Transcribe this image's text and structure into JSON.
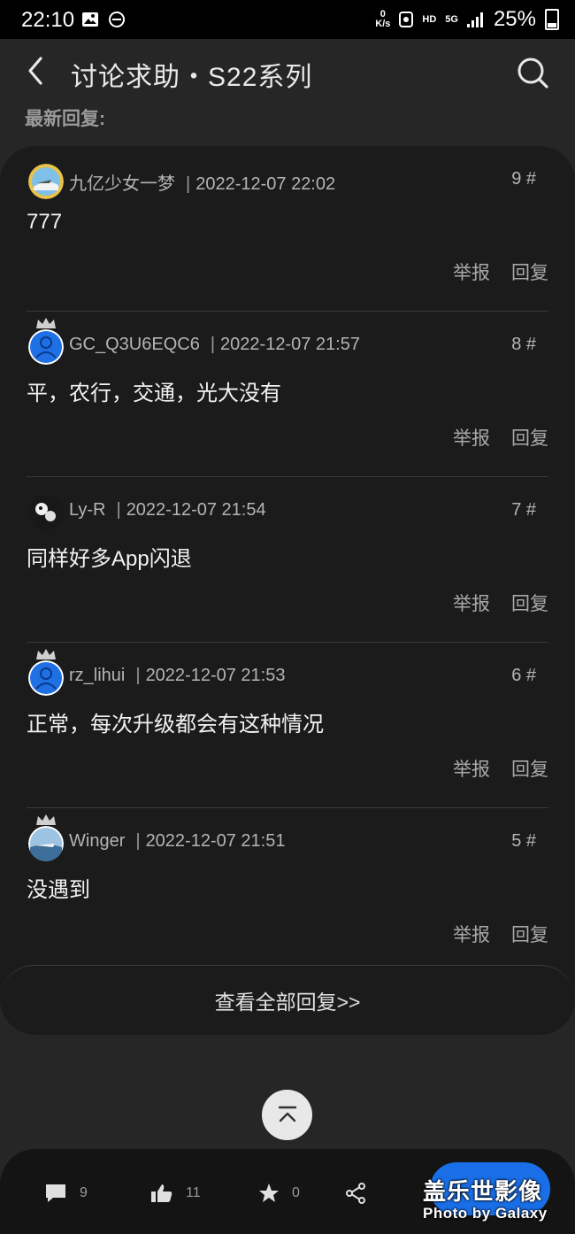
{
  "status_bar": {
    "time": "22:10",
    "net_speed_value": "0",
    "net_speed_unit": "K/s",
    "hd": "HD",
    "network": "5G",
    "battery": "25%"
  },
  "header": {
    "title": "讨论求助・S22系列",
    "back_icon": "chevron-left-icon",
    "search_icon": "search-icon"
  },
  "section_label": "最新回复:",
  "replies": [
    {
      "user": "九亿少女一梦",
      "time": "2022-12-07 22:02",
      "floor": "9 #",
      "text": "777",
      "avatar_color": "#6ab0e0",
      "crown": false
    },
    {
      "user": "GC_Q3U6EQC6",
      "time": "2022-12-07 21:57",
      "floor": "8 #",
      "text": "平，农行，交通，光大没有",
      "avatar_color": "#1f6fe5",
      "crown": true
    },
    {
      "user": "Ly-R",
      "time": "2022-12-07 21:54",
      "floor": "7 #",
      "text": "同样好多App闪退",
      "avatar_color": "#202020",
      "crown": false
    },
    {
      "user": "rz_lihui",
      "time": "2022-12-07 21:53",
      "floor": "6 #",
      "text": "正常，每次升级都会有这种情况",
      "avatar_color": "#1f6fe5",
      "crown": true
    },
    {
      "user": "Winger",
      "time": "2022-12-07 21:51",
      "floor": "5 #",
      "text": "没遇到",
      "avatar_color": "#8db7d8",
      "crown": true
    }
  ],
  "actions": {
    "report": "举报",
    "reply": "回复"
  },
  "view_all": "查看全部回复>>",
  "bottom_bar": {
    "comments": "9",
    "likes": "11",
    "favorites": "0"
  },
  "watermark": {
    "line1": "盖乐世影像",
    "line2": "Photo by Galaxy"
  }
}
